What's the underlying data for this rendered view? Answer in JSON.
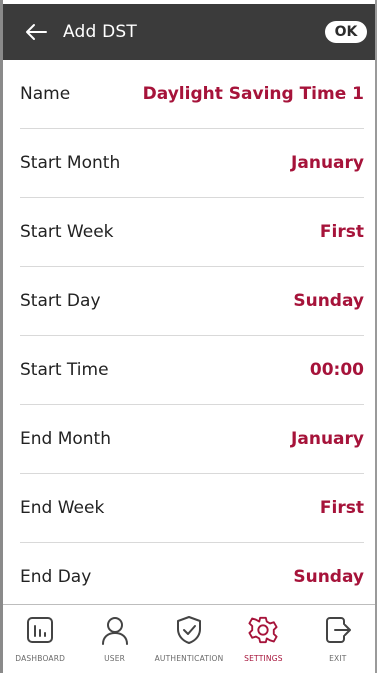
{
  "header": {
    "title": "Add DST",
    "ok_label": "OK"
  },
  "rows": [
    {
      "label": "Name",
      "value": "Daylight Saving Time 1"
    },
    {
      "label": "Start Month",
      "value": "January"
    },
    {
      "label": "Start Week",
      "value": "First"
    },
    {
      "label": "Start Day",
      "value": "Sunday"
    },
    {
      "label": "Start Time",
      "value": "00:00"
    },
    {
      "label": "End Month",
      "value": "January"
    },
    {
      "label": "End Week",
      "value": "First"
    },
    {
      "label": "End Day",
      "value": "Sunday"
    }
  ],
  "tabs": [
    {
      "label": "DASHBOARD",
      "icon": "dashboard-icon"
    },
    {
      "label": "USER",
      "icon": "user-icon"
    },
    {
      "label": "AUTHENTICATION",
      "icon": "authentication-icon"
    },
    {
      "label": "SETTINGS",
      "icon": "gear-icon",
      "active": true
    },
    {
      "label": "EXIT",
      "icon": "exit-icon"
    }
  ],
  "colors": {
    "accent": "#a6133a",
    "header_bg": "#3b3b3b"
  }
}
